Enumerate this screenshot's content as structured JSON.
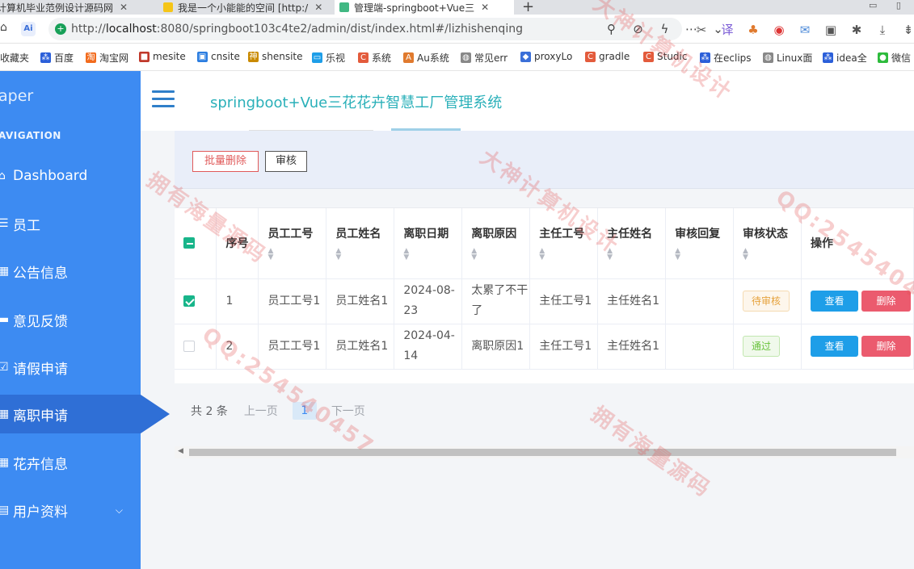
{
  "browser": {
    "tabs": [
      {
        "title": "计算机毕业范例设计源码网",
        "active": false
      },
      {
        "title": "我是一个小能能的空间 [http:/",
        "active": false
      },
      {
        "title": "管理端-springboot+Vue三",
        "active": true
      }
    ],
    "url_host": "localhost",
    "url_rest": ":8080/springboot103c4te2/admin/dist/index.html#/lizhishenqing",
    "url_prefix": "http://",
    "bookmarks": [
      "收藏夹",
      "百度",
      "淘宝网",
      "mesite",
      "cnsite",
      "shensite",
      "乐视",
      "系统",
      "Au系统",
      "常见err",
      "proxyLo",
      "gradle",
      "Studic",
      "在eclips",
      "Linux面",
      "idea全",
      "微信"
    ]
  },
  "sidebar": {
    "logo": "aper",
    "nav_label": "AVIGATION",
    "items": [
      {
        "label": "Dashboard",
        "icon": "home-icon"
      },
      {
        "label": "员工",
        "icon": "list-icon"
      },
      {
        "label": "公告信息",
        "icon": "grid-icon"
      },
      {
        "label": "意见反馈",
        "icon": "briefcase-icon"
      },
      {
        "label": "请假申请",
        "icon": "check-square-icon"
      },
      {
        "label": "离职申请",
        "icon": "grid-icon",
        "active": true
      },
      {
        "label": "花卉信息",
        "icon": "grid-icon"
      },
      {
        "label": "用户资料",
        "icon": "card-icon",
        "expandable": true
      }
    ]
  },
  "header": {
    "title": "springboot+Vue三花花卉智慧工厂管理系统"
  },
  "toolbar": {
    "batch_delete": "批量删除",
    "audit": "审核"
  },
  "table": {
    "columns": [
      "序号",
      "员工工号",
      "员工姓名",
      "离职日期",
      "离职原因",
      "主任工号",
      "主任姓名",
      "审核回复",
      "审核状态",
      "操作"
    ],
    "rows": [
      {
        "checked": true,
        "index": "1",
        "emp_no": "员工工号1",
        "emp_name": "员工姓名1",
        "date": "2024-08-23",
        "reason": "太累了不干了",
        "mgr_no": "主任工号1",
        "mgr_name": "主任姓名1",
        "reply": "",
        "status": "待审核",
        "status_type": "pending"
      },
      {
        "checked": false,
        "index": "2",
        "emp_no": "员工工号1",
        "emp_name": "员工姓名1",
        "date": "2024-04-14",
        "reason": "离职原因1",
        "mgr_no": "主任工号1",
        "mgr_name": "主任姓名1",
        "reply": "",
        "status": "通过",
        "status_type": "passed"
      }
    ],
    "view_label": "查看",
    "delete_label": "删除"
  },
  "pagination": {
    "total": "共 2 条",
    "prev": "上一页",
    "current": "1",
    "next": "下一页"
  },
  "watermark": {
    "texts": [
      "拥有海量源码",
      "大神计算机设计",
      "QQ:254540457"
    ]
  },
  "colors": {
    "sidebar": "#3d8bf2",
    "title": "#2ab0b9",
    "view_button": "#1e9ee8",
    "delete_button": "#eb5b6e"
  }
}
